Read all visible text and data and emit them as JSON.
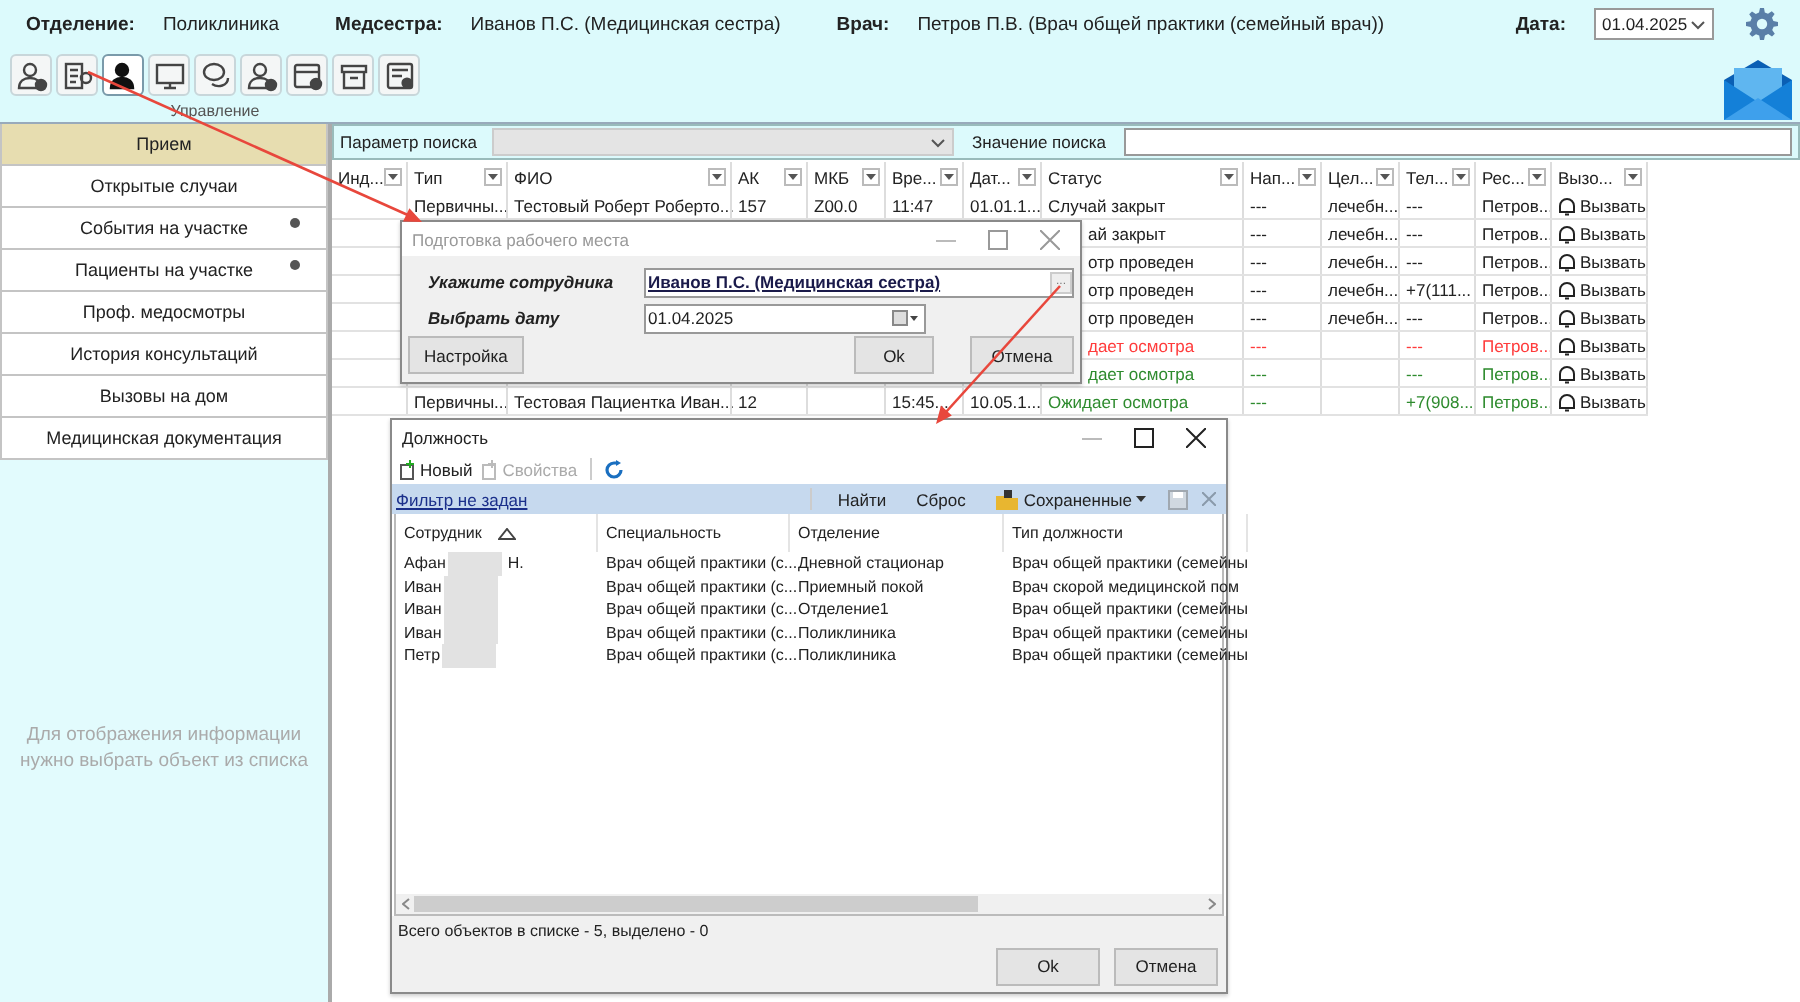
{
  "header": {
    "fields": [
      {
        "label": "Отделение:",
        "value": "Поликлиника"
      },
      {
        "label": "Медсестра:",
        "value": "Иванов П.С. (Медицинская сестра)"
      },
      {
        "label": "Врач:",
        "value": "Петров П.В. (Врач общей практики (семейный врач))"
      }
    ],
    "date_label": "Дата:",
    "date": "01.04.2025"
  },
  "toolbar": {
    "group_label": "Управление",
    "buttons": [
      {
        "selected": false
      },
      {
        "selected": false
      },
      {
        "selected": true
      },
      {
        "selected": false
      },
      {
        "selected": false
      },
      {
        "selected": false
      },
      {
        "selected": false
      },
      {
        "selected": false
      },
      {
        "selected": false
      }
    ]
  },
  "sidebar": {
    "items": [
      {
        "label": "Прием",
        "selected": true,
        "dot": false
      },
      {
        "label": "Открытые случаи",
        "selected": false,
        "dot": false
      },
      {
        "label": "События на участке",
        "selected": false,
        "dot": true
      },
      {
        "label": "Пациенты на участке",
        "selected": false,
        "dot": true
      },
      {
        "label": "Проф. медосмотры",
        "selected": false,
        "dot": false
      },
      {
        "label": "История консультаций",
        "selected": false,
        "dot": false
      },
      {
        "label": "Вызовы на дом",
        "selected": false,
        "dot": false
      },
      {
        "label": "Медицинская документация",
        "selected": false,
        "dot": false
      }
    ],
    "empty_message": "Для отображения информации нужно выбрать объект из списка"
  },
  "search": {
    "param_label": "Параметр поиска",
    "value_label": "Значение поиска"
  },
  "table": {
    "columns": [
      "Инд...",
      "Тип",
      "ФИО",
      "АК",
      "МКБ",
      "Вре...",
      "Дат...",
      "Статус",
      "Нап...",
      "Цел...",
      "Тел...",
      "Рес...",
      "Вызо..."
    ],
    "rows": [
      {
        "type": "Первичны...",
        "name": "Тестовый Роберт Роберто...",
        "ak": "157",
        "mkb": "Z00.0",
        "time": "11:47",
        "date": "01.01.1...",
        "status": "Случай закрыт",
        "referral": "---",
        "goal": "лечебн...",
        "phone": "---",
        "resource": "Петров...",
        "call": "Вызвать"
      },
      {
        "status": "ай закрыт",
        "referral": "---",
        "goal": "лечебн...",
        "phone": "---",
        "resource": "Петров...",
        "call": "Вызвать"
      },
      {
        "status": "отр проведен",
        "referral": "---",
        "goal": "лечебн...",
        "phone": "---",
        "resource": "Петров...",
        "call": "Вызвать"
      },
      {
        "status": "отр проведен",
        "referral": "---",
        "goal": "лечебн...",
        "phone": "+7(111...",
        "resource": "Петров...",
        "call": "Вызвать"
      },
      {
        "status": "отр проведен",
        "referral": "---",
        "goal": "лечебн...",
        "phone": "---",
        "resource": "Петров...",
        "call": "Вызвать"
      },
      {
        "status": "дает осмотра",
        "referral": "---",
        "phone": "---",
        "resource": "Петров...",
        "call": "Вызвать",
        "color": "#ff3b3b"
      },
      {
        "status": "дает осмотра",
        "referral": "---",
        "phone": "---",
        "resource": "Петров...",
        "call": "Вызвать",
        "color": "#2e8b2e"
      },
      {
        "type": "Первичны...",
        "name": "Тестовая Пациентка Иван...",
        "ak": "12",
        "time": "15:45...",
        "date": "10.05.1...",
        "status": "Ожидает осмотра",
        "referral": "---",
        "phone": "+7(908...",
        "resource": "Петров...",
        "call": "Вызвать",
        "color": "#2e8b2e"
      }
    ]
  },
  "prepare_dialog": {
    "title": "Подготовка рабочего места",
    "employee_label": "Укажите сотрудника",
    "employee": "Иванов П.С. (Медицинская сестра)",
    "browse": "...",
    "date_label": "Выбрать дату",
    "date": "01.04.2025",
    "settings_button": "Настройка",
    "ok_button": "Ok",
    "cancel_button": "Отмена"
  },
  "position_dialog": {
    "title": "Должность",
    "tools": [
      {
        "label": "Новый",
        "disabled": false
      },
      {
        "label": "Свойства",
        "disabled": true
      }
    ],
    "filter_link": "Фильтр не задан",
    "filter_buttons": [
      "Найти",
      "Сброс"
    ],
    "saved": "Сохраненные",
    "columns": [
      "Сотрудник",
      "Специальность",
      "Отделение",
      "Тип должности"
    ],
    "rows": [
      {
        "name_start": "Афан",
        "name_end": "Н.",
        "specialty": "Врач общей практики (с...",
        "department": "Дневной стационар",
        "position": "Врач общей практики (семейны"
      },
      {
        "name_start": "Иван",
        "specialty": "Врач общей практики (с...",
        "department": "Приемный покой",
        "position": "Врач скорой медицинской пом"
      },
      {
        "name_start": "Иван",
        "specialty": "Врач общей практики (с...",
        "department": "Отделение1",
        "position": "Врач общей практики (семейны"
      },
      {
        "name_start": "Иван",
        "specialty": "Врач общей практики (с...",
        "department": "Поликлиника",
        "position": "Врач общей практики (семейны"
      },
      {
        "name_start": "Петр",
        "specialty": "Врач общей практики (с...",
        "department": "Поликлиника",
        "position": "Врач общей практики (семейны"
      }
    ],
    "status": "Всего объектов в списке - 5, выделено - 0",
    "ok_button": "Ok",
    "cancel_button": "Отмена"
  }
}
